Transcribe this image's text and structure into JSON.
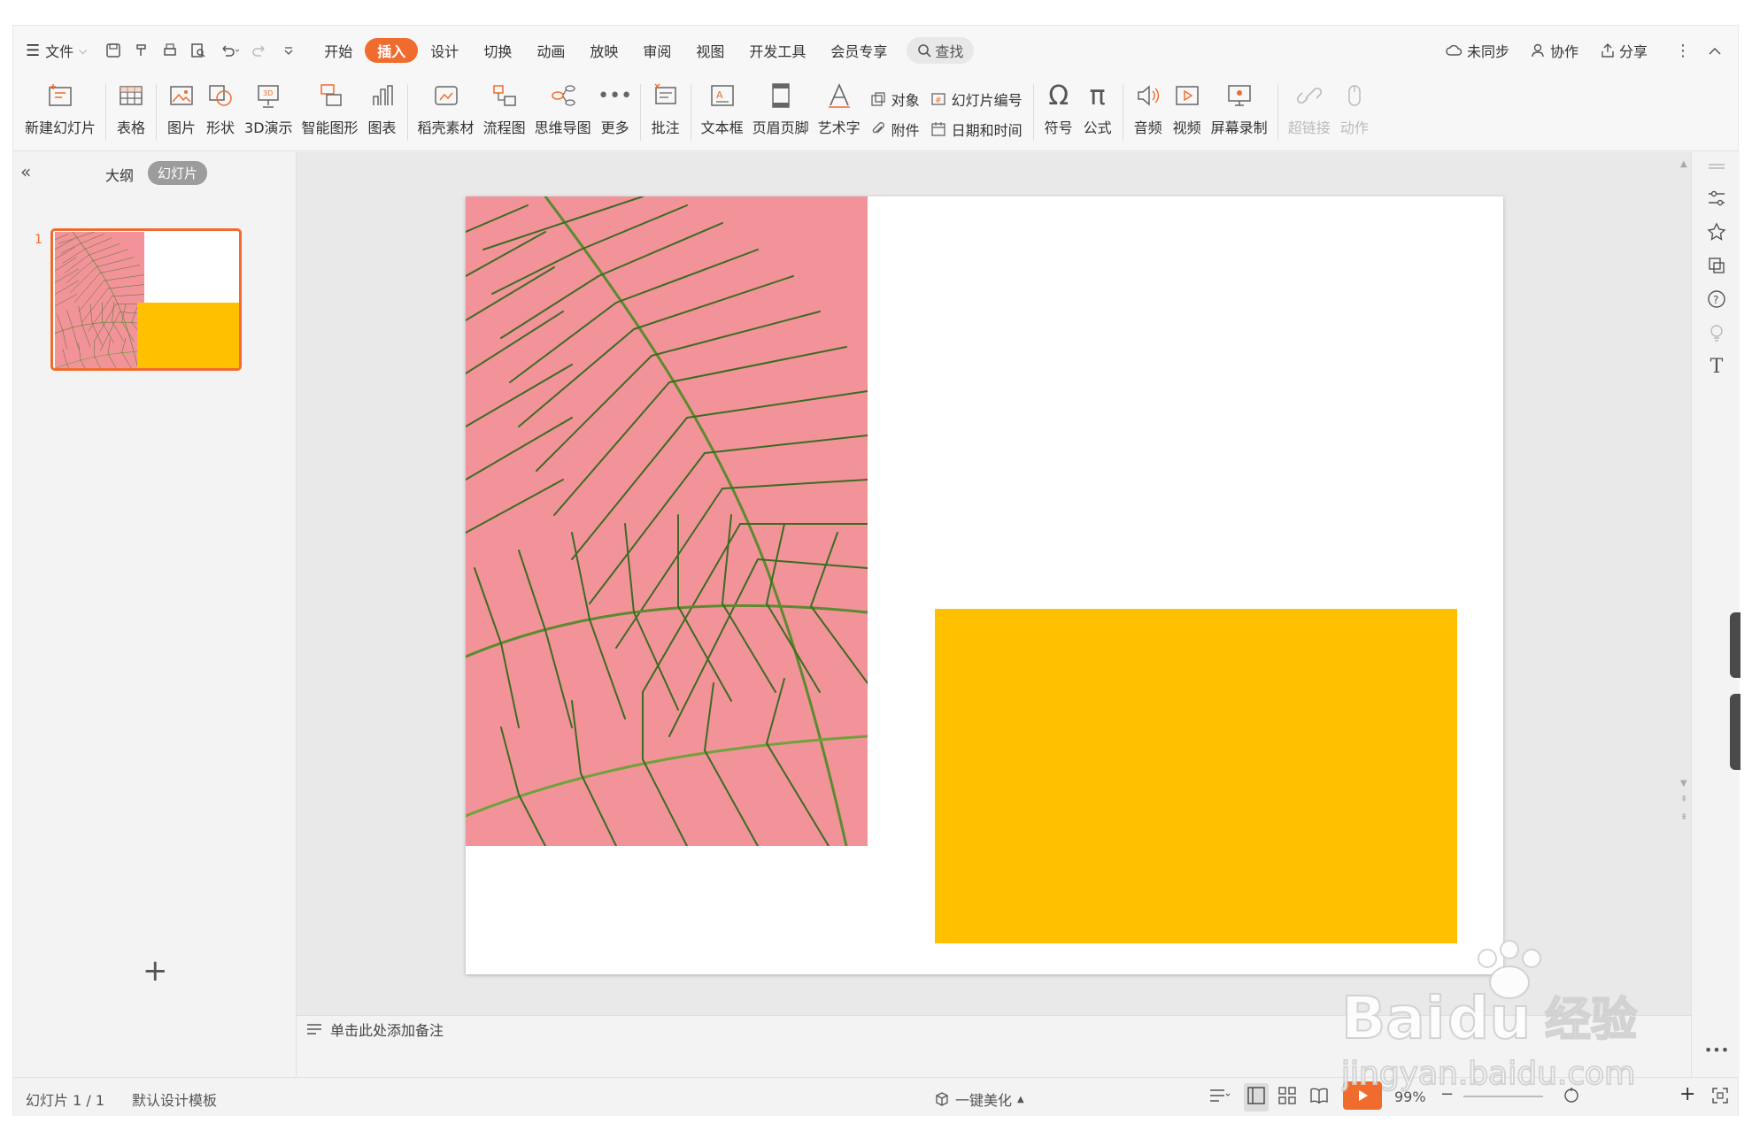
{
  "menubar": {
    "file_label": "文件",
    "tabs": [
      {
        "label": "开始",
        "active": false
      },
      {
        "label": "插入",
        "active": true
      },
      {
        "label": "设计",
        "active": false
      },
      {
        "label": "切换",
        "active": false
      },
      {
        "label": "动画",
        "active": false
      },
      {
        "label": "放映",
        "active": false
      },
      {
        "label": "审阅",
        "active": false
      },
      {
        "label": "视图",
        "active": false
      },
      {
        "label": "开发工具",
        "active": false
      },
      {
        "label": "会员专享",
        "active": false
      }
    ],
    "search_label": "查找",
    "sync_label": "未同步",
    "collab_label": "协作",
    "share_label": "分享"
  },
  "toolbar": {
    "new_slide": "新建幻灯片",
    "table": "表格",
    "picture": "图片",
    "shape": "形状",
    "3d": "3D演示",
    "smartart": "智能图形",
    "chart": "图表",
    "daoke": "稻壳素材",
    "flowchart": "流程图",
    "mindmap": "思维导图",
    "more": "更多",
    "comment": "批注",
    "textbox": "文本框",
    "header_footer": "页眉页脚",
    "wordart": "艺术字",
    "object": "对象",
    "slide_number": "幻灯片编号",
    "attachment": "附件",
    "datetime": "日期和时间",
    "symbol": "符号",
    "formula": "公式",
    "audio": "音频",
    "video": "视频",
    "screen_record": "屏幕录制",
    "hyperlink": "超链接",
    "action": "动作"
  },
  "left_panel": {
    "tab_outline": "大纲",
    "tab_slides": "幻灯片",
    "slide_number": "1"
  },
  "notes": {
    "placeholder": "单击此处添加备注"
  },
  "status": {
    "slide_info": "幻灯片 1 / 1",
    "template": "默认设计模板",
    "beautify": "一键美化",
    "zoom": "99%"
  },
  "colors": {
    "accent": "#f06c2e",
    "shape_fill": "#ffc000",
    "photo_bg": "#f08a92",
    "leaf": "#4e7a2a"
  }
}
